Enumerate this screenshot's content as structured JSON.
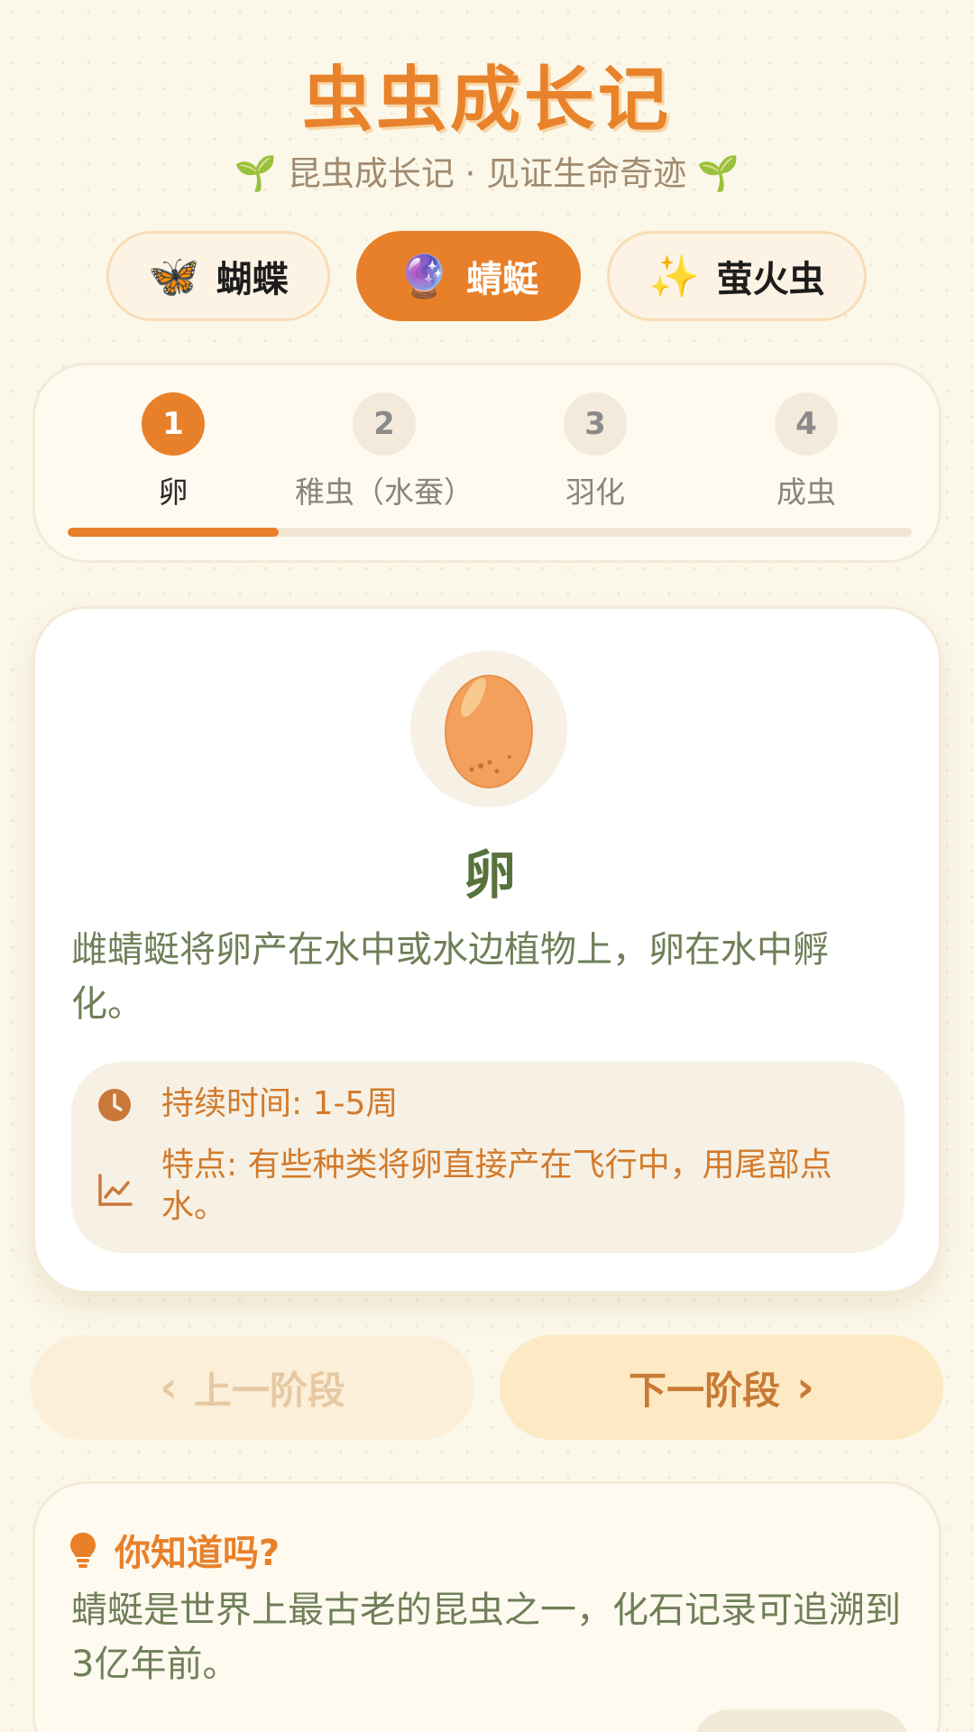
{
  "app": {
    "title": "虫虫成长记",
    "subtitle": "昆虫成长记 · 见证生命奇迹"
  },
  "species_tabs": [
    {
      "emoji": "🦋",
      "label": "蝴蝶",
      "active": false
    },
    {
      "emoji": "🔮",
      "label": "蜻蜓",
      "active": true
    },
    {
      "emoji": "✨",
      "label": "萤火虫",
      "active": false
    }
  ],
  "stages": [
    {
      "num": "1",
      "label": "卵",
      "active": true
    },
    {
      "num": "2",
      "label": "稚虫（水蚕）",
      "active": false
    },
    {
      "num": "3",
      "label": "羽化",
      "active": false
    },
    {
      "num": "4",
      "label": "成虫",
      "active": false
    }
  ],
  "progress": {
    "fraction": 0.25
  },
  "current_stage": {
    "icon": "egg-icon",
    "title": "卵",
    "description": "雌蜻蜓将卵产在水中或水边植物上，卵在水中孵化。",
    "duration": "持续时间: 1-5周",
    "feature": "特点: 有些种类将卵直接产在飞行中，用尾部点水。"
  },
  "navigation": {
    "prev_label": "上一阶段",
    "next_label": "下一阶段"
  },
  "fact": {
    "heading": "你知道吗?",
    "text": "蜻蜓是世界上最古老的昆虫之一，化石记录可追溯到3亿年前。"
  },
  "colors": {
    "accent": "#e8802a",
    "title_green": "#57723b",
    "body_text": "#6f7f58",
    "info_text": "#d27a2c",
    "background": "#fbf7e9"
  }
}
